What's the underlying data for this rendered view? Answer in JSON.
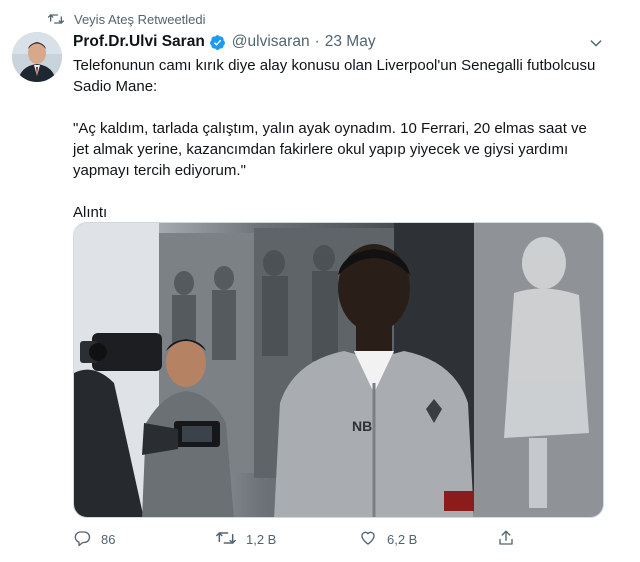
{
  "retweet_banner": {
    "text": "Veyis Ateş Retweetledi"
  },
  "tweet": {
    "display_name": "Prof.Dr.Ulvi Saran",
    "handle": "@ulvisaran",
    "separator": "·",
    "date": "23 May",
    "text": {
      "line1": "Telefonunun camı kırık diye alay konusu olan Liverpool'un Senegalli futbolcusu Sadio Mane:",
      "quote": "\"Aç kaldım, tarlada çalıştım, yalın ayak oynadım. 10 Ferrari, 20 elmas saat ve jet almak yerine, kazancımdan fakirlere okul yapıp yiyecek ve giysi yardımı yapmayı tercih ediyorum.\"",
      "source": "Alıntı"
    },
    "media": {
      "jersey_lettering": "NB"
    }
  },
  "actions": {
    "replies": "86",
    "retweets": "1,2 B",
    "likes": "6,2 B"
  },
  "icons": {
    "retweet": "retweet-icon",
    "verified": "verified-badge-icon",
    "caret": "chevron-down-icon",
    "reply": "reply-icon",
    "like": "heart-icon",
    "share": "share-icon"
  },
  "colors": {
    "verified_blue": "#1d9bf0",
    "muted_text": "#536471",
    "primary_text": "#0f1419"
  }
}
